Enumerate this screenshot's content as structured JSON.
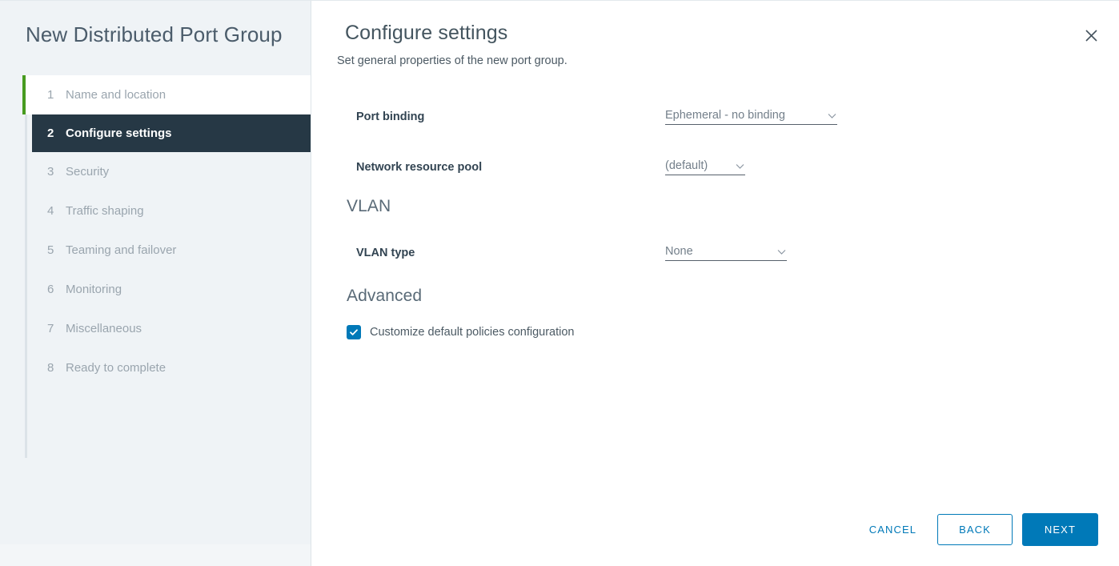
{
  "sidebar": {
    "wizard_title": "New Distributed Port Group",
    "steps": [
      {
        "num": "1",
        "label": "Name and location",
        "state": "completed"
      },
      {
        "num": "2",
        "label": "Configure settings",
        "state": "active"
      },
      {
        "num": "3",
        "label": "Security",
        "state": "pending"
      },
      {
        "num": "4",
        "label": "Traffic shaping",
        "state": "pending"
      },
      {
        "num": "5",
        "label": "Teaming and failover",
        "state": "pending"
      },
      {
        "num": "6",
        "label": "Monitoring",
        "state": "pending"
      },
      {
        "num": "7",
        "label": "Miscellaneous",
        "state": "pending"
      },
      {
        "num": "8",
        "label": "Ready to complete",
        "state": "pending"
      }
    ]
  },
  "main": {
    "title": "Configure settings",
    "subtitle": "Set general properties of the new port group.",
    "close_icon": "close-icon",
    "fields": [
      {
        "label": "Port binding",
        "value": "Ephemeral - no binding",
        "icon": "chevron-down-icon"
      },
      {
        "label": "Network resource pool",
        "value": "(default)",
        "icon": "chevron-down-icon"
      }
    ],
    "vlan": {
      "section_title": "VLAN",
      "type_label": "VLAN type",
      "type_value": "None",
      "icon": "chevron-down-icon"
    },
    "advanced": {
      "section_title": "Advanced",
      "checkbox_label": "Customize default policies configuration",
      "checkbox_checked": true,
      "check_icon": "check-icon"
    }
  },
  "footer": {
    "cancel_label": "CANCEL",
    "back_label": "BACK",
    "next_label": "NEXT"
  },
  "colors": {
    "accent_blue": "#0079b8",
    "active_step_bg": "#263845",
    "completed_accent_green": "#479b1f",
    "sidebar_bg": "#eff3f6",
    "label_text": "#324452",
    "muted_text": "#9aa5ae"
  }
}
